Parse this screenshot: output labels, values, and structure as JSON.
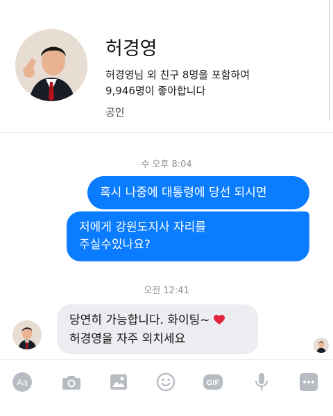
{
  "profile": {
    "name": "허경영",
    "likes_line1": "허경영님 외 친구 8명을 포함하여",
    "likes_line2": "9,946명이 좋아합니다",
    "category": "공인"
  },
  "conversation": {
    "timestamp_1": "수 오후 8:04",
    "sent_message_1": "혹시 나중에 대통령에 당선 되시면",
    "sent_message_2_line1": "저에게 강원도지사 자리를",
    "sent_message_2_line2": "주실수있나요?",
    "timestamp_2": "오전 12:41",
    "received_message_line1": "당연히 가능합니다. 화이팅~",
    "received_message_line2": "허경영을 자주 외치세요"
  },
  "toolbar": {
    "items": [
      "Aa",
      "camera-icon",
      "gallery-icon",
      "emoji-icon",
      "GIF",
      "microphone-icon",
      "more-icon"
    ]
  },
  "colors": {
    "sent_bubble": "#0a7cff",
    "received_bubble": "#ebedf0",
    "toolbar_icon": "#b7bcc3",
    "heart": "#e0243c"
  }
}
